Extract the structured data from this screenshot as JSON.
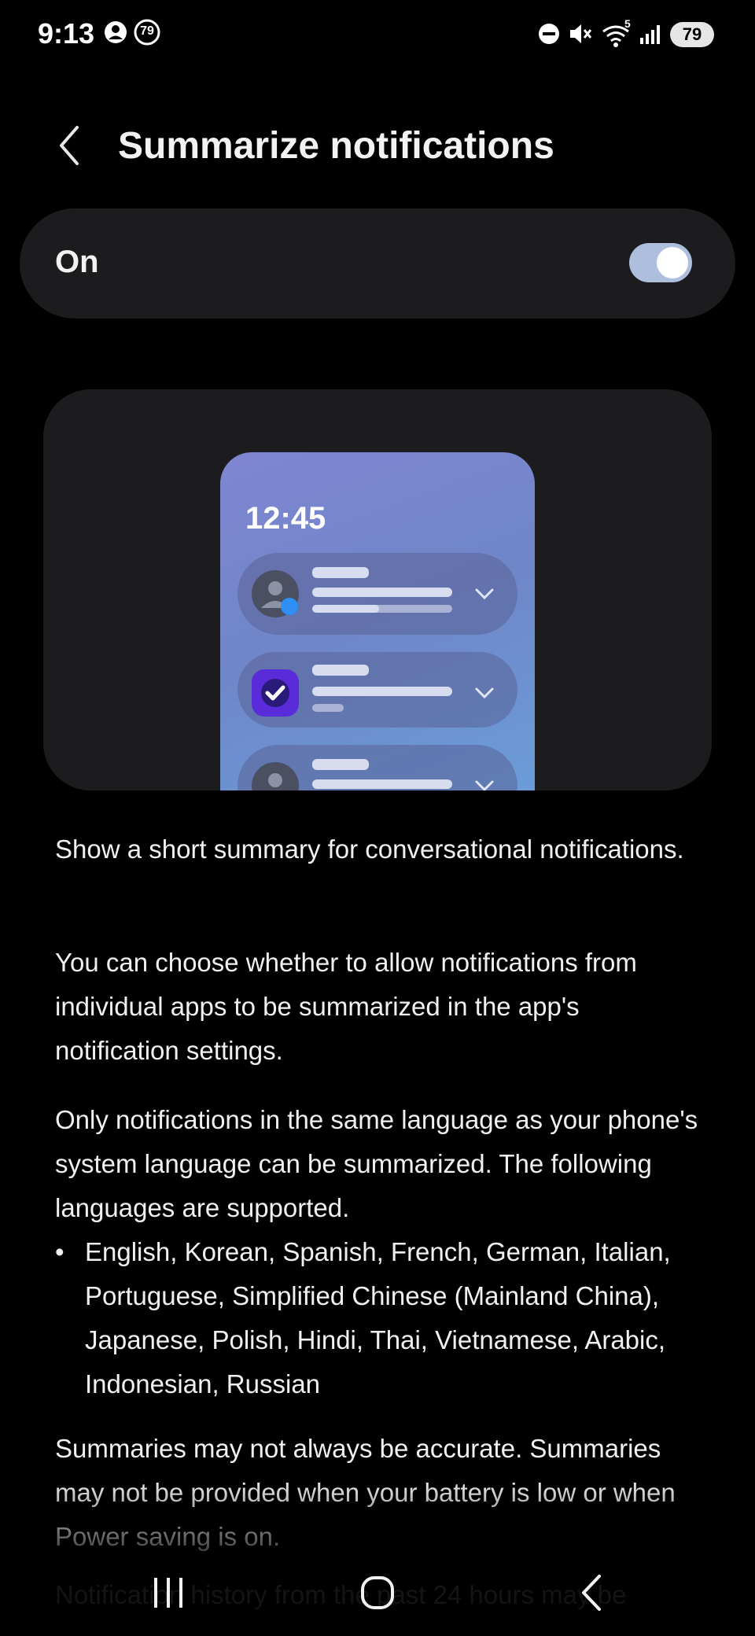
{
  "status_bar": {
    "time": "9:13",
    "badge_number": "79",
    "signal_label": "5",
    "battery_level": "79",
    "icons": [
      "person-circle-icon",
      "number-badge-icon",
      "dnd-icon",
      "mute-icon",
      "wifi-icon",
      "signal-icon",
      "battery-icon"
    ]
  },
  "header": {
    "title": "Summarize notifications",
    "back_icon": "back-chevron-icon"
  },
  "toggle": {
    "label": "On",
    "state": true,
    "accent": "#aebedd"
  },
  "illustration": {
    "clock": "12:45",
    "gradient": [
      "#7f86d2",
      "#6aa0dc"
    ],
    "notifications": [
      {
        "icon": "person-avatar-icon"
      },
      {
        "icon": "checkmark-app-icon"
      },
      {
        "icon": "person-avatar-icon"
      }
    ]
  },
  "content": {
    "p1": "Show a short summary for conversational notifications.",
    "p2": "You can choose whether to allow notifications from individual apps to be summarized in the app's notification settings.",
    "p3": "Only notifications in the same language as your phone's system language can be summarized. The following languages are supported.",
    "bullet": "•",
    "languages": "English, Korean, Spanish, French, German, Italian, Portuguese, Simplified Chinese (Mainland China), Japanese, Polish, Hindi, Thai, Vietnamese, Arabic, Indonesian, Russian",
    "p4": "Summaries may not always be accurate. Summaries may not be provided when your battery is low or when Power saving is on.",
    "p5": "Notification history from the past 24 hours may be"
  },
  "nav_bar": {
    "icons": [
      "recents-icon",
      "home-icon",
      "back-icon"
    ]
  }
}
